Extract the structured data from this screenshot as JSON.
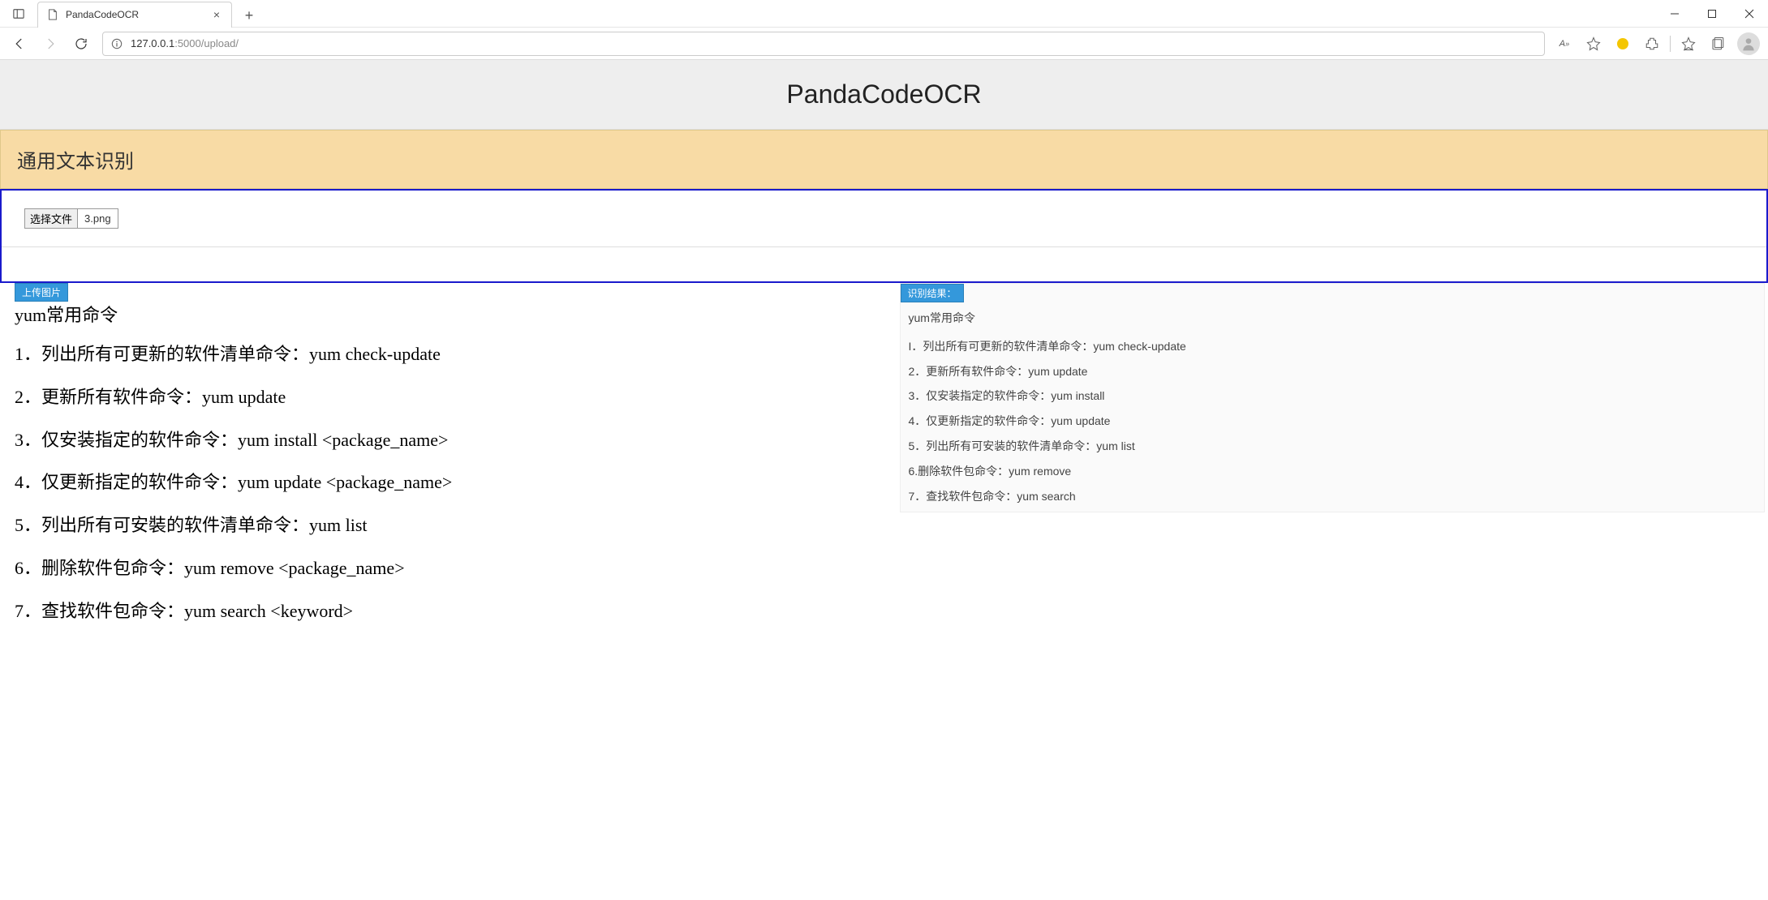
{
  "browser": {
    "tab_title": "PandaCodeOCR",
    "url_host": "127.0.0.1",
    "url_port_path": ":5000/upload/"
  },
  "page": {
    "title": "PandaCodeOCR",
    "section_heading": "通用文本识别",
    "file_button": "选择文件",
    "file_name": "3.png",
    "upload_badge": "上传图片",
    "result_badge": "识别结果："
  },
  "uploaded_image_text": {
    "heading": "yum常用命令",
    "lines": [
      "1．列出所有可更新的软件清单命令：yum check-update",
      "2．更新所有软件命令：yum update",
      "3．仅安装指定的软件命令：yum install <package_name>",
      "4．仅更新指定的软件命令：yum update <package_name>",
      "5．列出所有可安裝的软件清单命令：yum list",
      "6．删除软件包命令：yum remove <package_name>",
      "7．查找软件包命令：yum search <keyword>"
    ]
  },
  "ocr_result": {
    "heading": "yum常用命令",
    "lines": [
      "I．列出所有可更新的软件清单命令：yum check-update",
      "2．更新所有软件命令：yum update",
      "3．仅安装指定的软件命令：yum install",
      "4．仅更新指定的软件命令：yum update",
      "5．列出所有可安装的软件清单命令：yum list",
      "6.删除软件包命令：yum remove",
      "7．查找软件包命令：yum search"
    ]
  }
}
